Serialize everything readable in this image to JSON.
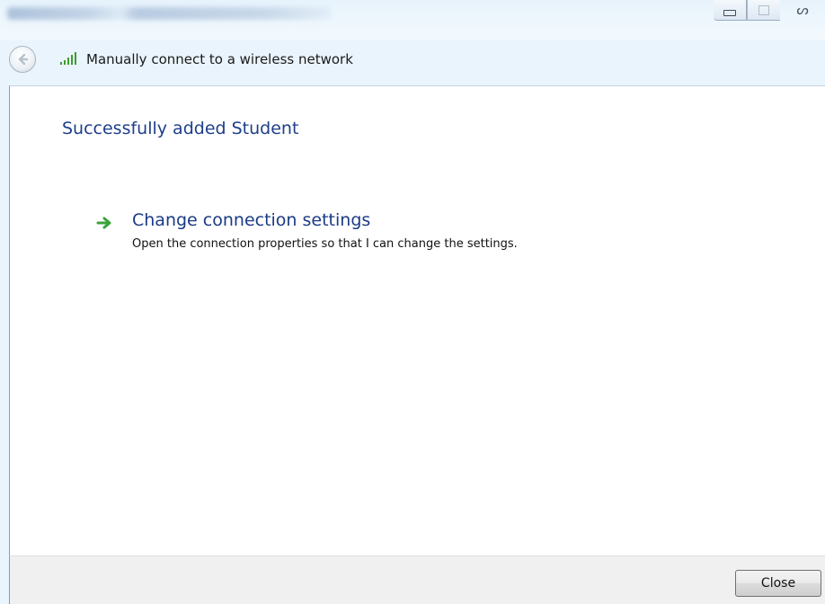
{
  "window": {
    "controls": {
      "minimize_icon": "minimize-icon",
      "maximize_icon": "maximize-icon",
      "close_icon": "close-x-icon",
      "close_glyph": "ᔕ"
    }
  },
  "nav": {
    "back_icon": "back-arrow-icon",
    "signal_icon": "wireless-signal-icon",
    "title": "Manually connect to a wireless network"
  },
  "main": {
    "heading": "Successfully added Student",
    "options": [
      {
        "icon": "green-arrow-icon",
        "title": "Change connection settings",
        "description": "Open the connection properties so that I can change the settings."
      }
    ]
  },
  "footer": {
    "close_label": "Close"
  },
  "colors": {
    "heading": "#1e3f8a",
    "link": "#1a3a86",
    "arrow": "#3aa33a",
    "signal": "#3d9c2f"
  }
}
